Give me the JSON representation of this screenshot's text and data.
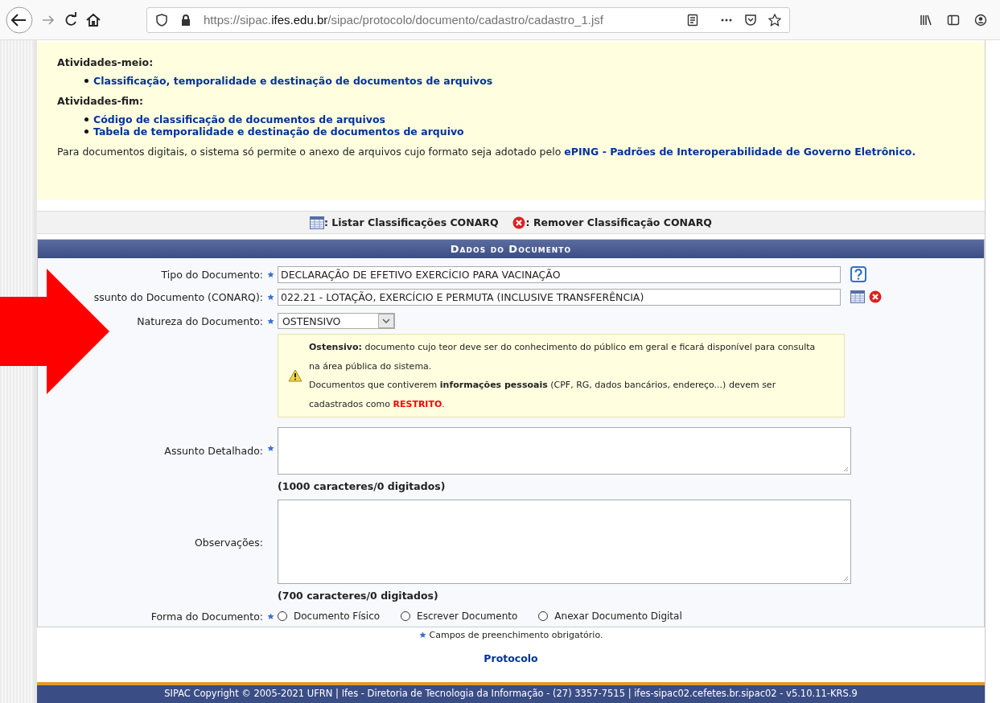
{
  "browser": {
    "url": "https://sipac.**ifes.edu.br**/sipac/protocolo/documento/cadastro/cadastro_1.jsf"
  },
  "info": {
    "sections": [
      {
        "heading": "Atividades-meio:",
        "links": [
          "Classificação, temporalidade e destinação de documentos de arquivos"
        ]
      },
      {
        "heading": "Atividades-fim:",
        "links": [
          "Código de classificação de documentos de arquivos",
          "Tabela de temporalidade e destinação de documentos de arquivo"
        ]
      }
    ],
    "note": "Para documentos digitais, o sistema só permite o anexo de arquivos cujo formato seja adotado pelo",
    "note_link": "ePING - Padrões de Interoperabilidade de Governo Eletrônico."
  },
  "actions": [
    {
      "kind": "list",
      "label": ": Listar Classificações CONARQ"
    },
    {
      "kind": "remove",
      "label": ": Remover Classificação CONARQ"
    }
  ],
  "section_title": "Dados do Documento",
  "fields": [
    {
      "kind": "text",
      "label": "Tipo do Documento:",
      "required": true,
      "value": "DECLARAÇÃO DE EFETIVO EXERCÍCIO PARA VACINAÇÃO",
      "buttons": [
        {
          "kind": "help"
        }
      ]
    },
    {
      "kind": "text",
      "label": "ssunto do Documento (CONARQ):",
      "required": true,
      "value": "022.21 - LOTAÇÃO, EXERCÍCIO E PERMUTA (INCLUSIVE TRANSFERÊNCIA)",
      "buttons": [
        {
          "kind": "list"
        },
        {
          "kind": "remove"
        }
      ]
    },
    {
      "kind": "select",
      "label": "Natureza do Documento:",
      "required": true,
      "value": "OSTENSIVO"
    },
    {
      "kind": "notice",
      "paragraphs": [
        {
          "text": "**Ostensivo:** documento cujo teor deve ser do conhecimento do público em geral e ficará disponível para consulta na área pública do sistema."
        },
        {
          "text": "Documentos que contiverem **informações pessoais** (CPF, RG, dados bancários, endereço...) devem ser cadastrados como ",
          "alert": "RESTRITO",
          "end": "."
        }
      ]
    },
    {
      "kind": "textarea",
      "label": "Assunto Detalhado:",
      "required": true,
      "counter": "(1000 caracteres/0 digitados)"
    },
    {
      "kind": "textarea",
      "label": "Observações:",
      "required": false,
      "counter": "(700 caracteres/0 digitados)"
    },
    {
      "kind": "radio",
      "label": "Forma do Documento:",
      "required": true,
      "options": [
        {
          "label": "Documento Físico",
          "selected": false
        },
        {
          "label": "Escrever Documento",
          "selected": false
        },
        {
          "label": "Anexar Documento Digital",
          "selected": false
        }
      ]
    }
  ],
  "required_note": "Campos de preenchimento obrigatório.",
  "bottom_link": "Protocolo",
  "footer": "SIPAC Copyright © 2005-2021 UFRN | Ifes - Diretoria de Tecnologia da Informação - (27) 3357-7515 | ifes-sipac02.cefetes.br.sipac02 - v5.10.11-KRS.9"
}
